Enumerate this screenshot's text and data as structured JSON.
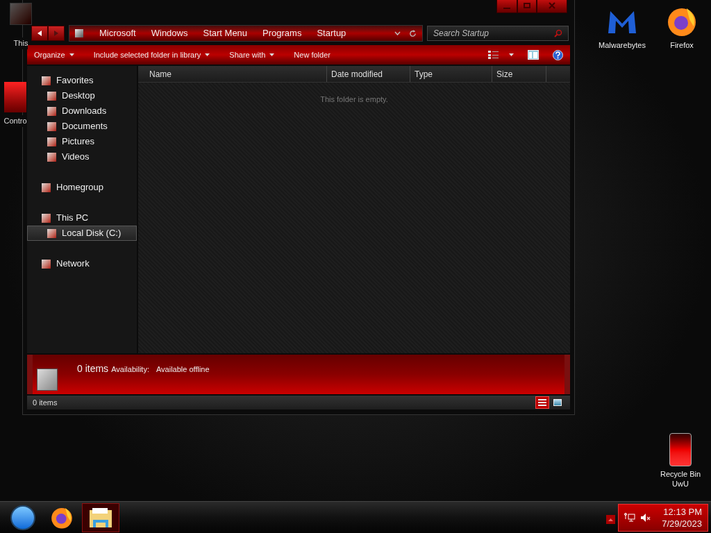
{
  "desktop_icons_left": [
    {
      "label": "This",
      "kind": "pc"
    },
    {
      "label": "Contro",
      "kind": "control"
    }
  ],
  "desktop_icons_right": [
    {
      "label": "Malwarebytes",
      "kind": "malware"
    },
    {
      "label": "Firefox",
      "kind": "firefox"
    },
    {
      "label": "Recycle Bin UwU",
      "kind": "bin"
    }
  ],
  "window": {
    "breadcrumb": [
      "Microsoft",
      "Windows",
      "Start Menu",
      "Programs",
      "Startup"
    ],
    "search": {
      "placeholder": "Search Startup"
    },
    "toolbar": [
      {
        "label": "Organize",
        "dropdown": true
      },
      {
        "label": "Include selected folder in library",
        "dropdown": true
      },
      {
        "label": "Share with",
        "dropdown": true
      },
      {
        "label": "New folder",
        "dropdown": false
      }
    ],
    "nav": [
      {
        "label": "Favorites",
        "selected": false,
        "children": [
          {
            "label": "Desktop",
            "selected": false
          },
          {
            "label": "Downloads",
            "selected": false
          },
          {
            "label": "Documents",
            "selected": false
          },
          {
            "label": "Pictures",
            "selected": false
          },
          {
            "label": "Videos",
            "selected": false
          }
        ]
      },
      {
        "label": "Homegroup",
        "selected": false
      },
      {
        "label": "This PC",
        "selected": false,
        "children": [
          {
            "label": "Local Disk (C:)",
            "selected": true
          }
        ]
      },
      {
        "label": "Network",
        "selected": false
      }
    ],
    "columns": [
      "Name",
      "Date modified",
      "Type",
      "Size"
    ],
    "empty_message": "This folder is empty.",
    "details": {
      "count": "0 items",
      "availability_label": "Availability:",
      "availability": "Available offline"
    },
    "status": "0 items",
    "views": [
      {
        "kind": "details",
        "selected": true
      },
      {
        "kind": "preview",
        "selected": false
      }
    ]
  },
  "taskbar": {
    "pinned": [
      {
        "kind": "start",
        "selected": false
      },
      {
        "kind": "firefox",
        "selected": false
      },
      {
        "kind": "explorer",
        "selected": true
      }
    ],
    "time": "12:13 PM",
    "date": "7/29/2023"
  }
}
